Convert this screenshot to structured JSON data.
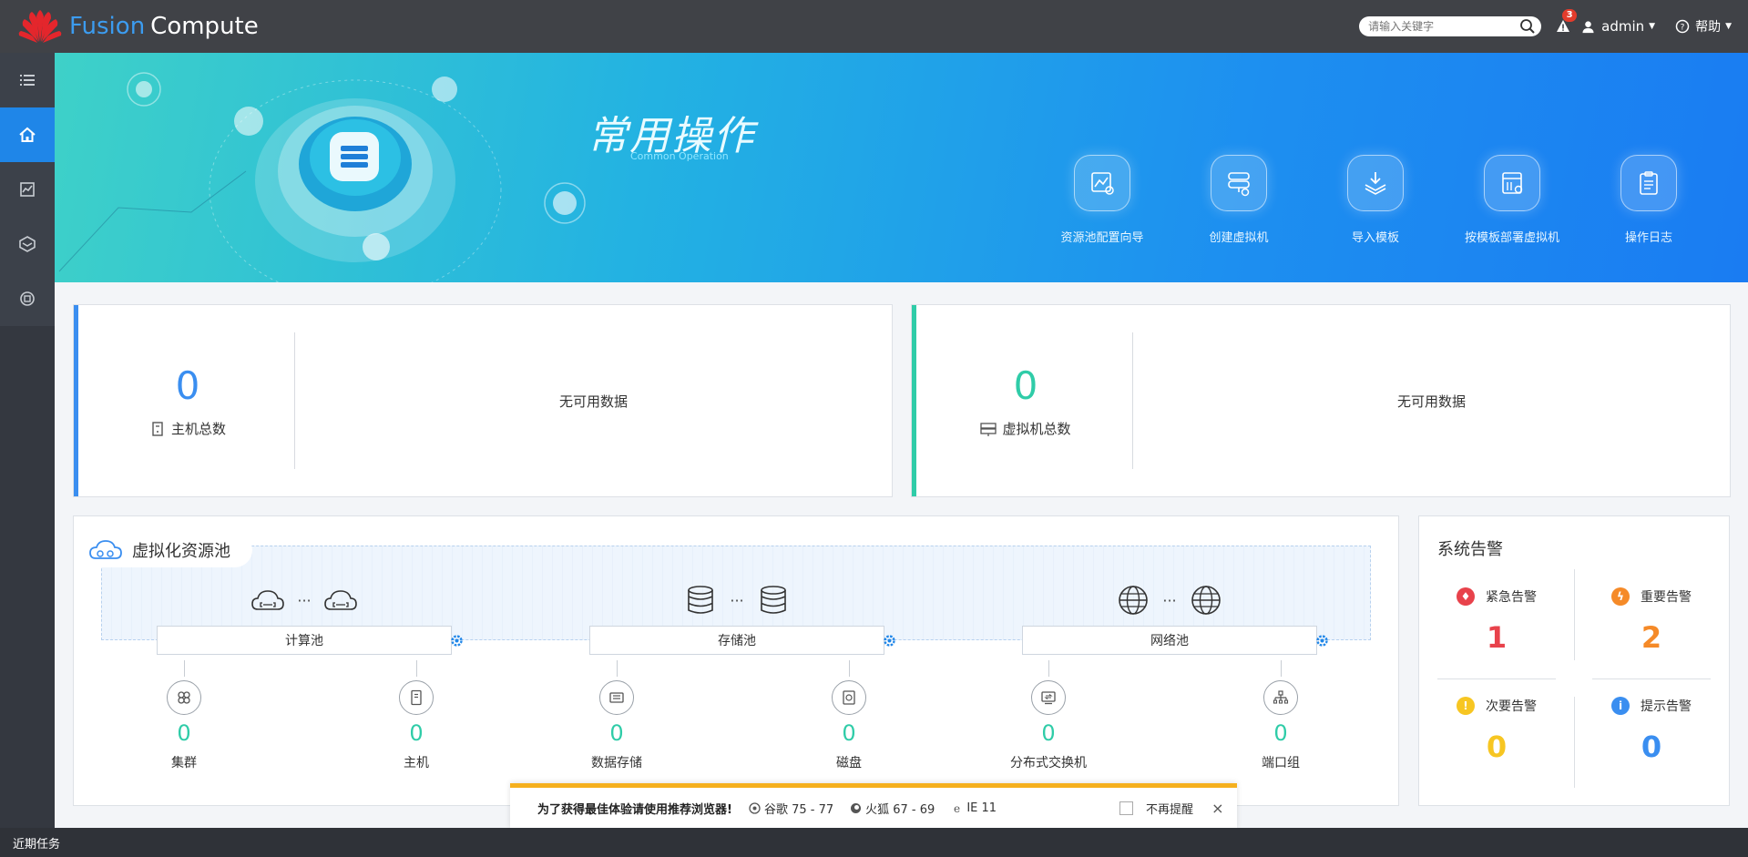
{
  "header": {
    "logo_fusion": "Fusion",
    "logo_compute": "Compute",
    "search_placeholder": "请输入关键字",
    "alarm_count": "3",
    "user": "admin",
    "help": "帮助"
  },
  "sidebar": {
    "items": [
      {
        "icon": "list-icon",
        "active": false
      },
      {
        "icon": "home-icon",
        "active": true
      },
      {
        "icon": "monitor-icon",
        "active": false
      },
      {
        "icon": "layers-icon",
        "active": false
      },
      {
        "icon": "resource-icon",
        "active": false
      }
    ]
  },
  "banner": {
    "title": "常用操作",
    "subtitle": "Common Operation",
    "operations": [
      {
        "label": "资源池配置向导",
        "icon": "resource-wizard-icon"
      },
      {
        "label": "创建虚拟机",
        "icon": "create-vm-icon"
      },
      {
        "label": "导入模板",
        "icon": "import-template-icon"
      },
      {
        "label": "按模板部署虚拟机",
        "icon": "deploy-template-icon"
      },
      {
        "label": "操作日志",
        "icon": "operation-log-icon"
      }
    ]
  },
  "summary": {
    "hosts": {
      "value": "0",
      "label": "主机总数",
      "nodata": "无可用数据",
      "color": "#3a8ef0"
    },
    "vms": {
      "value": "0",
      "label": "虚拟机总数",
      "nodata": "无可用数据",
      "color": "#2fcca8"
    }
  },
  "pool": {
    "title": "虚拟化资源池",
    "groups": [
      {
        "label": "计算池",
        "icon": "cloud-icon"
      },
      {
        "label": "存储池",
        "icon": "database-icon"
      },
      {
        "label": "网络池",
        "icon": "globe-icon"
      }
    ],
    "dots": "···",
    "metrics": [
      {
        "label": "集群",
        "value": "0",
        "icon": "cluster-icon"
      },
      {
        "label": "主机",
        "value": "0",
        "icon": "host-icon"
      },
      {
        "label": "数据存储",
        "value": "0",
        "icon": "datastore-icon"
      },
      {
        "label": "磁盘",
        "value": "0",
        "icon": "disk-icon"
      },
      {
        "label": "分布式交换机",
        "value": "0",
        "icon": "switch-icon"
      },
      {
        "label": "端口组",
        "value": "0",
        "icon": "portgroup-icon"
      }
    ]
  },
  "alarms": {
    "title": "系统告警",
    "items": [
      {
        "label": "紧急告警",
        "value": "1",
        "color": "#e8424b"
      },
      {
        "label": "重要告警",
        "value": "2",
        "color": "#f58a28"
      },
      {
        "label": "次要告警",
        "value": "0",
        "color": "#f7c622"
      },
      {
        "label": "提示告警",
        "value": "0",
        "color": "#3a8ef0"
      }
    ]
  },
  "tip": {
    "message": "为了获得最佳体验请使用推荐浏览器!",
    "chrome": "谷歌 75 - 77",
    "firefox": "火狐 67 - 69",
    "ie": "IE 11",
    "dismiss": "不再提醒",
    "close": "×"
  },
  "footer": {
    "recent_tasks": "近期任务"
  }
}
